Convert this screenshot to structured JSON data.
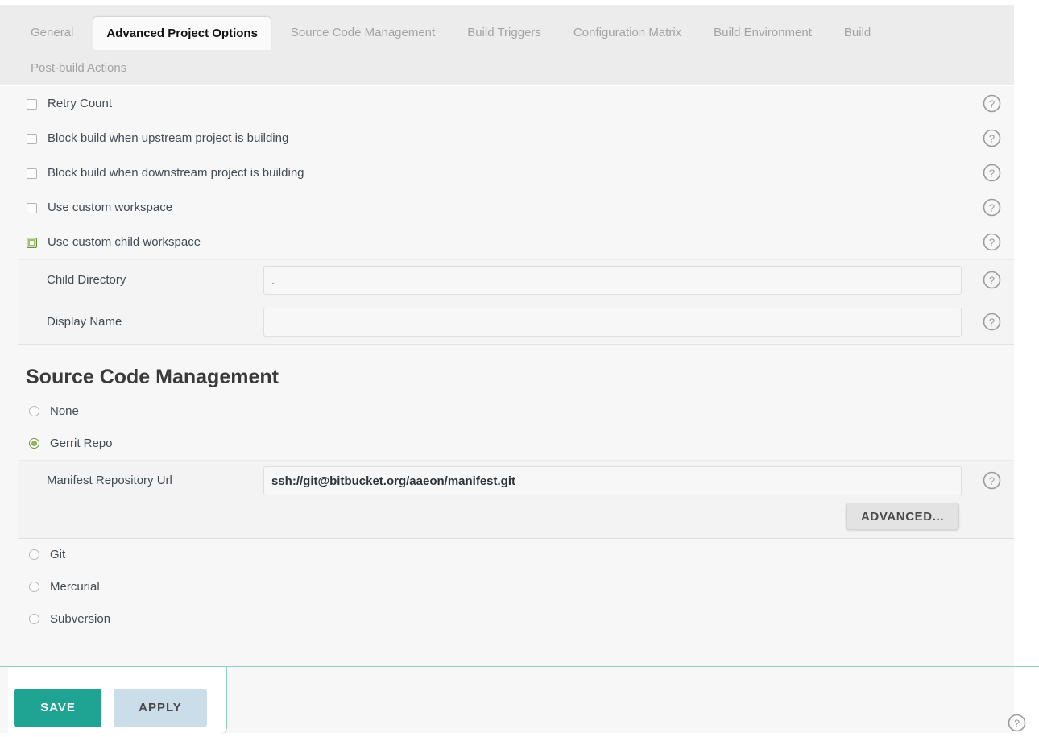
{
  "tabs": {
    "row1": [
      {
        "label": "General",
        "active": false
      },
      {
        "label": "Advanced Project Options",
        "active": true
      },
      {
        "label": "Source Code Management",
        "active": false
      },
      {
        "label": "Build Triggers",
        "active": false
      },
      {
        "label": "Configuration Matrix",
        "active": false
      },
      {
        "label": "Build Environment",
        "active": false
      },
      {
        "label": "Build",
        "active": false
      }
    ],
    "row2": [
      {
        "label": "Post-build Actions",
        "active": false
      }
    ]
  },
  "advanced_options": {
    "checkboxes": [
      {
        "label": "Retry Count",
        "checked": false
      },
      {
        "label": "Block build when upstream project is building",
        "checked": false
      },
      {
        "label": "Block build when downstream project is building",
        "checked": false
      },
      {
        "label": "Use custom workspace",
        "checked": false
      },
      {
        "label": "Use custom child workspace",
        "checked": true
      }
    ],
    "child_workspace_fields": [
      {
        "label": "Child Directory",
        "value": ".",
        "placeholder": ""
      },
      {
        "label": "Display Name",
        "value": "",
        "placeholder": ""
      }
    ]
  },
  "scm": {
    "title": "Source Code Management",
    "options_top": [
      {
        "label": "None",
        "selected": false
      },
      {
        "label": "Gerrit Repo",
        "selected": true
      }
    ],
    "gerrit": {
      "url_label": "Manifest Repository Url",
      "url_value": "ssh://git@bitbucket.org/aaeon/manifest.git",
      "advanced_label": "ADVANCED..."
    },
    "options_bottom": [
      {
        "label": "Git",
        "selected": false
      },
      {
        "label": "Mercurial",
        "selected": false
      },
      {
        "label": "Subversion",
        "selected": false
      }
    ]
  },
  "footer": {
    "save_label": "SAVE",
    "apply_label": "APPLY"
  },
  "colors": {
    "save_button": "#1fa392",
    "apply_button": "#cadde9",
    "checked_checkbox": "#9fbf68",
    "selected_radio": "#8fb357",
    "panel_background": "#f7f7f7",
    "tab_bar_background": "#ececec"
  },
  "icons": {
    "help": "help-circle-icon"
  }
}
